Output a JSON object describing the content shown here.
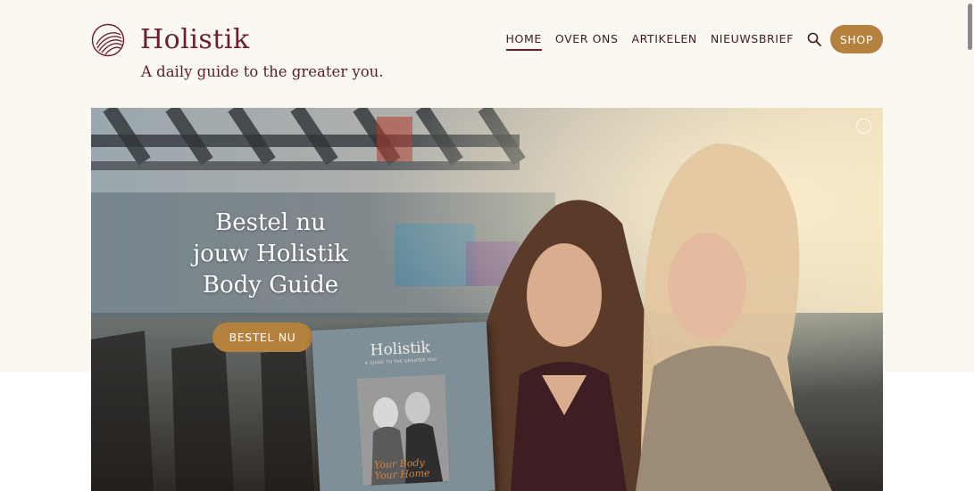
{
  "site": {
    "logo_text": "Holistik",
    "tagline": "A daily guide to the greater you."
  },
  "nav": {
    "items": [
      {
        "label": "HOME",
        "active": true
      },
      {
        "label": "OVER ONS",
        "active": false
      },
      {
        "label": "ARTIKELEN",
        "active": false
      },
      {
        "label": "NIEUWSBRIEF",
        "active": false
      }
    ],
    "search_icon": "search-icon",
    "shop_label": "SHOP"
  },
  "hero": {
    "title_line1": "Bestel nu",
    "title_line2": "jouw Holistik",
    "title_line3": "Body Guide",
    "button_label": "BESTEL NU",
    "magazine": {
      "title": "Holistik",
      "subtitle": "A GUIDE TO THE GREATER YOU",
      "cover_text_line1": "Your Body",
      "cover_text_line2": "Your Home"
    }
  },
  "colors": {
    "brand": "#6b1f2a",
    "accent": "#b5813f",
    "band": "#fbf7f1"
  }
}
